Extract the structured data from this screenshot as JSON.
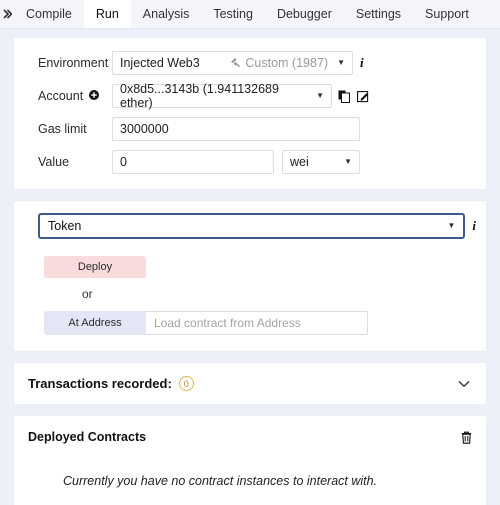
{
  "tabbar": {
    "arrow_icon": "chevrons-right-icon",
    "tabs": [
      {
        "label": "Compile",
        "active": false
      },
      {
        "label": "Run",
        "active": true
      },
      {
        "label": "Analysis",
        "active": false
      },
      {
        "label": "Testing",
        "active": false
      },
      {
        "label": "Debugger",
        "active": false
      },
      {
        "label": "Settings",
        "active": false
      },
      {
        "label": "Support",
        "active": false
      }
    ]
  },
  "settings": {
    "environment": {
      "label": "Environment",
      "value": "Injected Web3",
      "network": "Custom (1987)",
      "plug_icon": "plug-icon",
      "caret": "▼",
      "info_icon": "i"
    },
    "account": {
      "label": "Account",
      "plus_icon": "⊕",
      "value": "0x8d5...3143b (1.941132689 ether)",
      "caret": "▼",
      "copy_icon": "copy-icon",
      "edit_icon": "edit-icon"
    },
    "gas_limit": {
      "label": "Gas limit",
      "value": "3000000"
    },
    "value": {
      "label": "Value",
      "value": "0",
      "unit": "wei",
      "caret": "▼"
    }
  },
  "deploy": {
    "contract": "Token",
    "caret": "▼",
    "info_icon": "i",
    "deploy_label": "Deploy",
    "or_label": "or",
    "at_address_label": "At Address",
    "at_address_value": "",
    "at_address_placeholder": "Load contract from Address"
  },
  "transactions": {
    "title": "Transactions recorded:",
    "count": "0",
    "chevron": "⌄"
  },
  "deployed_contracts": {
    "title": "Deployed Contracts",
    "trash_icon": "trash-icon",
    "empty_message": "Currently you have no contract instances to interact with."
  },
  "colors": {
    "page_bg": "#eef0f9",
    "tabbar_bg": "#f4f5fb",
    "deploy_btn": "#fadbdb",
    "at_address_btn": "#e3e6f5",
    "select_focus_border": "#3b5b8c",
    "badge_border": "#e0b84b"
  }
}
